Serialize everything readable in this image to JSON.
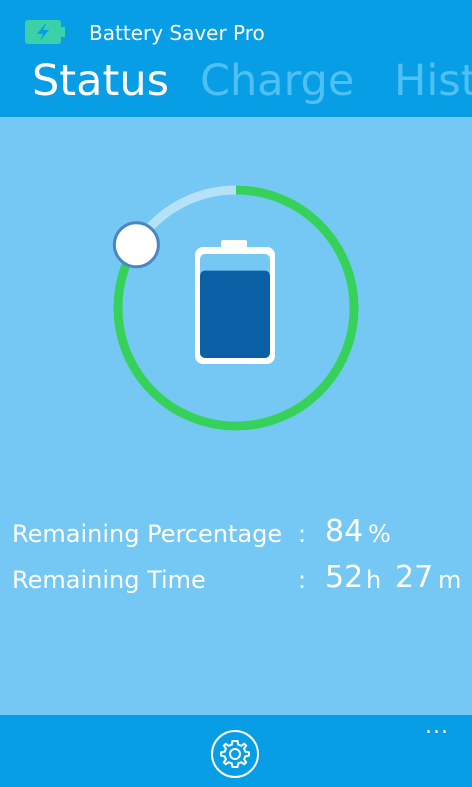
{
  "app": {
    "title": "Battery Saver Pro",
    "icon": "battery-charging-icon"
  },
  "tabs": [
    {
      "label": "Status",
      "active": true
    },
    {
      "label": "Charge",
      "active": false
    },
    {
      "label": "Hist",
      "active": false
    }
  ],
  "gauge": {
    "percent": 84,
    "ring_color": "#35d15a",
    "track_color": "#b5e2f9",
    "battery_fill_color": "#0b5fa5"
  },
  "stats": {
    "percentage": {
      "label": "Remaining Percentage",
      "colon": ":",
      "value": "84",
      "unit": "%"
    },
    "time": {
      "label": "Remaining Time",
      "colon": ":",
      "hours": "52",
      "hours_unit": "h",
      "minutes": "27",
      "minutes_unit": "m"
    }
  },
  "appbar": {
    "settings_icon": "gear-icon",
    "more_label": "..."
  },
  "colors": {
    "header_bg": "#089ee6",
    "content_bg": "#74c8f3",
    "inactive_tab": "#4fc0f3"
  }
}
